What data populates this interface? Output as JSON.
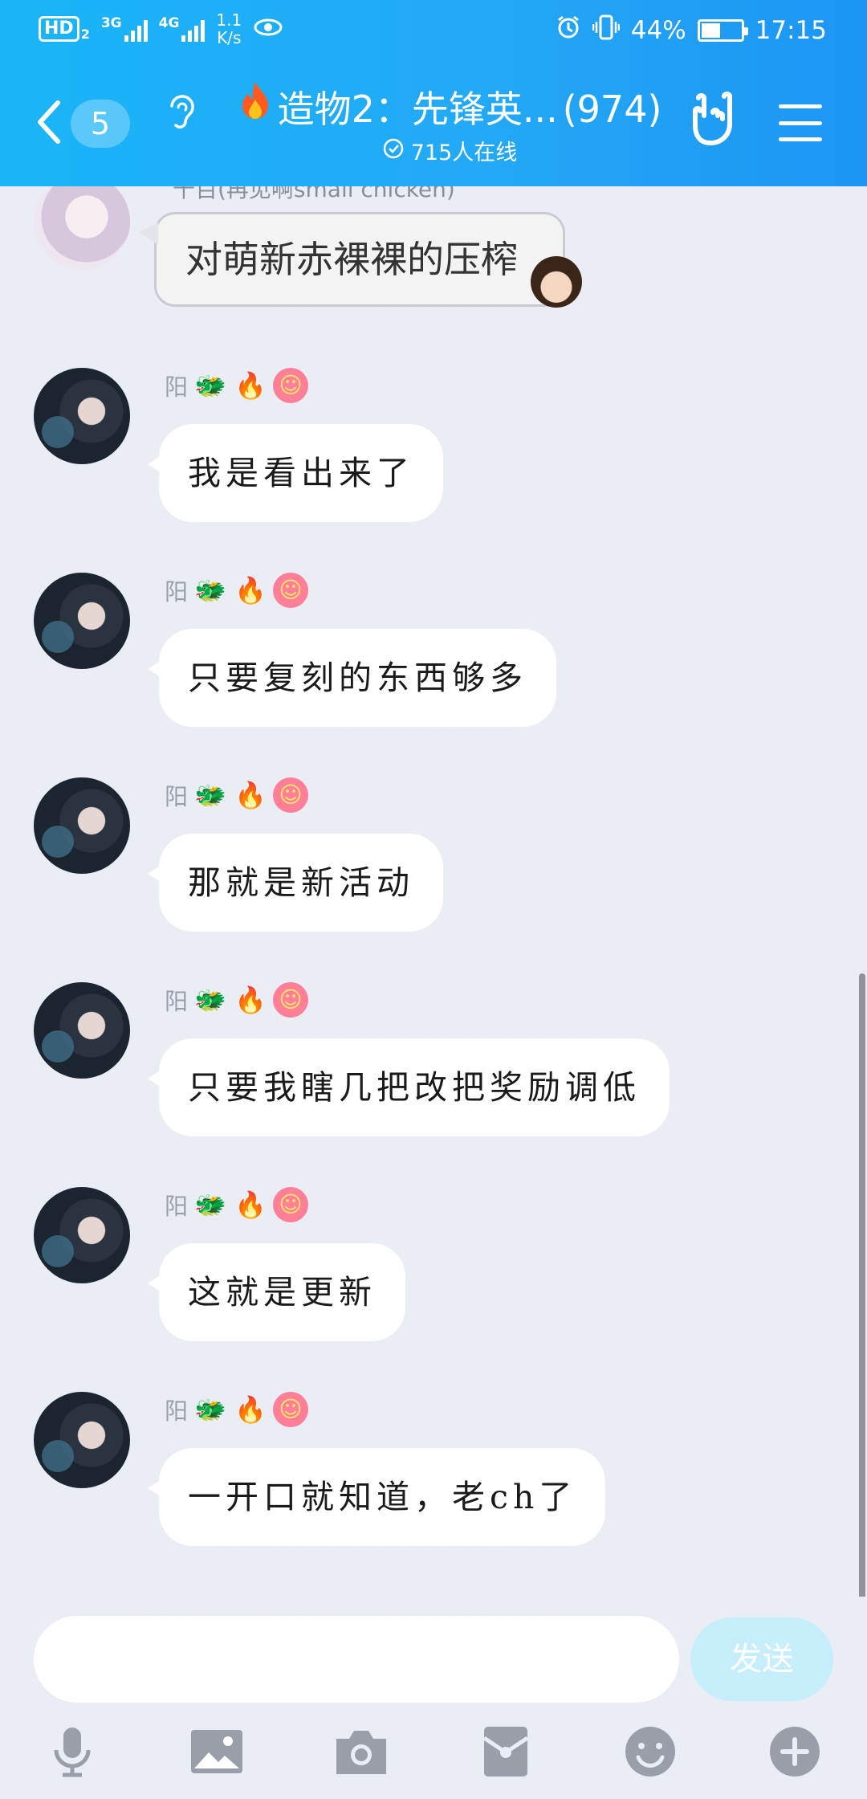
{
  "status_bar": {
    "hd": "HD",
    "hd_sub": "2",
    "net1": "3G",
    "net2": "4G",
    "speed_value": "1.1",
    "speed_unit": "K/s",
    "battery_percent": "44%",
    "battery_level": 0.44,
    "time": "17:15"
  },
  "header": {
    "unread_count": "5",
    "group_name": "造物2：先锋英...",
    "member_count": "(974)",
    "online_text": "715人在线"
  },
  "messages": [
    {
      "sender": "千百(再见啊small chicken)",
      "text": "对萌新赤裸裸的压榨",
      "style": "fancy"
    },
    {
      "sender": "阳",
      "text": "我是看出来了"
    },
    {
      "sender": "阳",
      "text": "只要复刻的东西够多"
    },
    {
      "sender": "阳",
      "text": "那就是新活动"
    },
    {
      "sender": "阳",
      "text": "只要我瞎几把改把奖励调低"
    },
    {
      "sender": "阳",
      "text": "这就是更新"
    },
    {
      "sender": "阳",
      "text": "一开口就知道，老ch了"
    }
  ],
  "input": {
    "placeholder": "",
    "send_label": "发送"
  },
  "toolbar": {
    "icons": [
      "microphone-icon",
      "image-icon",
      "camera-icon",
      "red-packet-icon",
      "emoji-icon",
      "plus-icon"
    ]
  },
  "colors": {
    "header_start": "#19b5f7",
    "header_end": "#1c95f3",
    "chat_background": "#ebedf4",
    "send_button": "#c6eefb"
  }
}
